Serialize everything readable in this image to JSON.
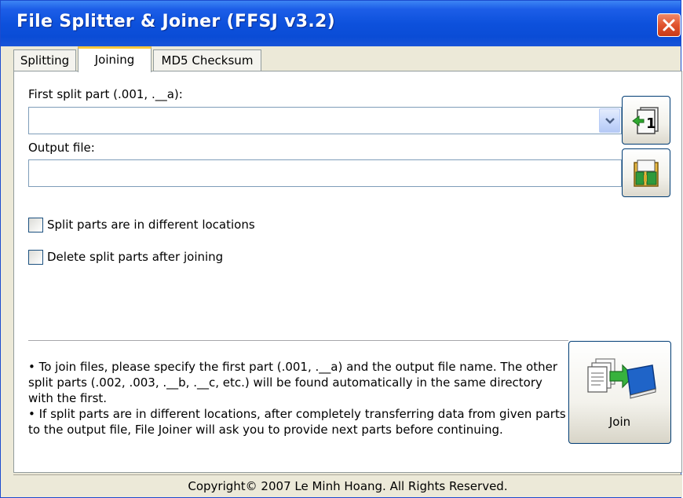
{
  "window": {
    "title": "File Splitter & Joiner (FFSJ v3.2)"
  },
  "tabs": [
    {
      "label": "Splitting",
      "active": false
    },
    {
      "label": "Joining",
      "active": true
    },
    {
      "label": "MD5 Checksum",
      "active": false
    }
  ],
  "joining": {
    "first_part_label": "First split part (.001, .__a):",
    "first_part_value": "",
    "output_label": "Output file:",
    "output_value": "",
    "browse_first_icon": "first-part-icon",
    "browse_output_icon": "output-folder-icon",
    "options": [
      {
        "label": "Split parts are in different locations",
        "checked": false
      },
      {
        "label": "Delete split parts after joining",
        "checked": false
      }
    ],
    "info_lines": [
      "• To join files, please specify the first part (.001, .__a) and the output file name. The other split parts (.002, .003, .__b, .__c, etc.) will be found automatically in the same directory with the first.",
      "• If split parts are in different locations, after completely transferring data from given parts to the output file, File Joiner will ask you to provide next parts before continuing."
    ],
    "join_button_label": "Join"
  },
  "status": {
    "copyright": "Copyright© 2007 Le Minh Hoang. All Rights Reserved."
  },
  "colors": {
    "title_bar": "#0a4cd6",
    "active_tab_accent": "#ffc83c",
    "close_button": "#e0532e"
  }
}
